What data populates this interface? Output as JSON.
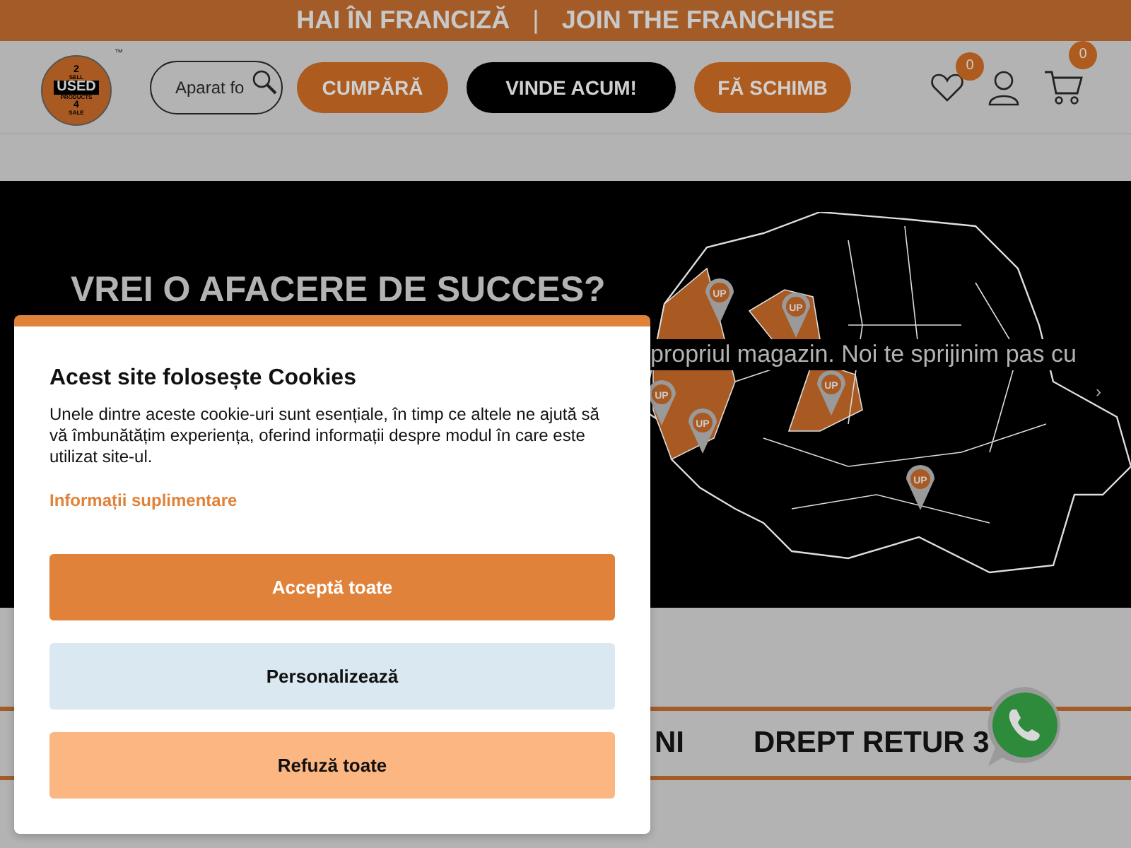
{
  "top_bar": {
    "links": [
      "HAI ÎN FRANCIZĂ",
      "JOIN THE FRANCHISE"
    ],
    "separator": "|"
  },
  "header": {
    "logo": {
      "lines": [
        "2",
        "SELL",
        "USED",
        "PRODUCTS",
        "4",
        "SALE"
      ],
      "tm": "™"
    },
    "search": {
      "value": "Aparat fo"
    },
    "buttons": [
      {
        "label": "CUMPĂRĂ",
        "kind": "orange"
      },
      {
        "label": "VINDE ACUM!",
        "kind": "dark"
      },
      {
        "label": "FĂ SCHIMB",
        "kind": "orange"
      }
    ],
    "wishlist_count": "0",
    "cart_count": "0"
  },
  "hero": {
    "title": "VREI O AFACERE DE SUCCES?",
    "text": "propriul magazin. Noi te sprijinim pas cu",
    "next": "›",
    "pins": [
      {
        "label": "UP"
      },
      {
        "label": "UP"
      },
      {
        "label": "UP"
      },
      {
        "label": "UP"
      },
      {
        "label": "UP"
      },
      {
        "label": "UP"
      }
    ]
  },
  "features": [
    "NI",
    "DREPT RETUR 3"
  ],
  "cookie_dialog": {
    "title": "Acest site folosește Cookies",
    "text": "Unele dintre aceste cookie-uri sunt esențiale, în timp ce altele ne ajută să vă îmbunătățim experiența, oferind informații despre modul în care este utilizat site-ul.",
    "link": "Informații suplimentare",
    "buttons": [
      {
        "label": "Acceptă toate",
        "kind": "accept"
      },
      {
        "label": "Personalizează",
        "kind": "customize"
      },
      {
        "label": "Refuză toate",
        "kind": "reject"
      }
    ]
  }
}
